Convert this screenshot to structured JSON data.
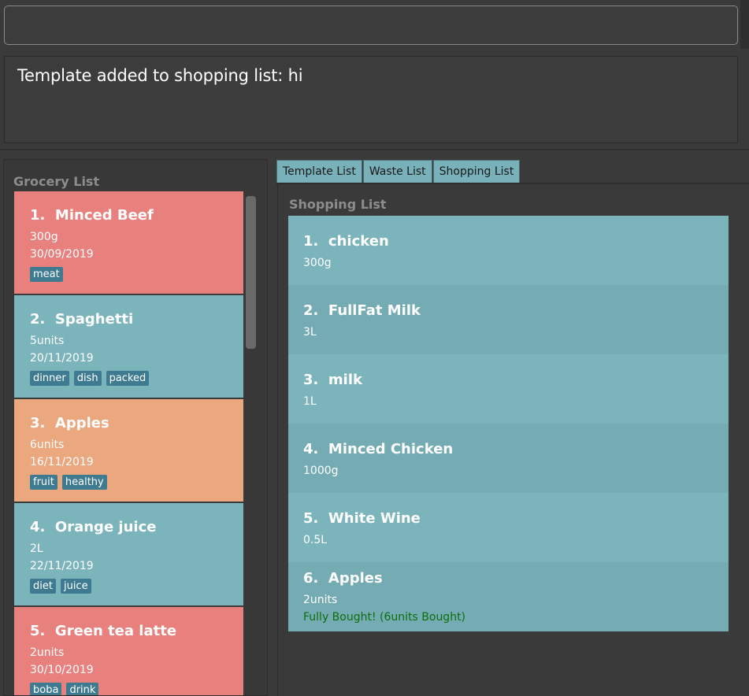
{
  "command": {
    "value": ""
  },
  "result": {
    "text": "Template added to shopping list: hi"
  },
  "grocery": {
    "title": "Grocery List",
    "items": [
      {
        "index": "1.",
        "name": "Minced Beef",
        "amount": "300g",
        "date": "30/09/2019",
        "tags": [
          "meat"
        ],
        "color": "#e8807e"
      },
      {
        "index": "2.",
        "name": "Spaghetti",
        "amount": "5units",
        "date": "20/11/2019",
        "tags": [
          "dinner",
          "dish",
          "packed"
        ],
        "color": "#7cb4bc"
      },
      {
        "index": "3.",
        "name": "Apples",
        "amount": "6units",
        "date": "16/11/2019",
        "tags": [
          "fruit",
          "healthy"
        ],
        "color": "#eba77d"
      },
      {
        "index": "4.",
        "name": "Orange juice",
        "amount": "2L",
        "date": "22/11/2019",
        "tags": [
          "diet",
          "juice"
        ],
        "color": "#7cb4bc"
      },
      {
        "index": "5.",
        "name": "Green tea latte",
        "amount": "2units",
        "date": "30/10/2019",
        "tags": [
          "boba",
          "drink"
        ],
        "color": "#e8807e"
      }
    ]
  },
  "tabs": [
    {
      "label": "Template List"
    },
    {
      "label": "Waste List"
    },
    {
      "label": "Shopping List"
    }
  ],
  "shopping": {
    "title": "Shopping List",
    "items": [
      {
        "index": "1.",
        "name": "chicken",
        "amount": "300g"
      },
      {
        "index": "2.",
        "name": "FullFat Milk",
        "amount": "3L"
      },
      {
        "index": "3.",
        "name": "milk",
        "amount": "1L"
      },
      {
        "index": "4.",
        "name": "Minced Chicken",
        "amount": "1000g"
      },
      {
        "index": "5.",
        "name": "White Wine",
        "amount": "0.5L"
      },
      {
        "index": "6.",
        "name": "Apples",
        "amount": "2units",
        "status": "Fully Bought! (6units Bought)"
      }
    ]
  }
}
